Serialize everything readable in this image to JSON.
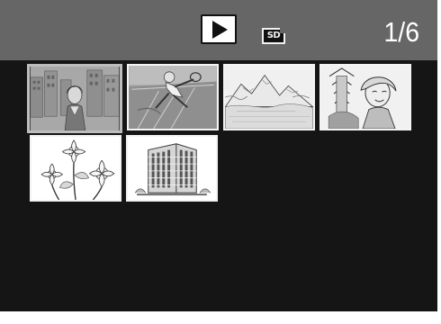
{
  "header": {
    "mode_icon": "play-icon",
    "storage_icon": "sd-card-icon",
    "storage_label": "SD",
    "counter": "1/6"
  },
  "thumbnails": [
    {
      "subject": "woman-city-photo",
      "selected": true
    },
    {
      "subject": "tennis-player-photo",
      "selected": false
    },
    {
      "subject": "mountain-lake-photo",
      "selected": false
    },
    {
      "subject": "woman-temple-photo",
      "selected": false
    },
    {
      "subject": "flowers-photo",
      "selected": false
    },
    {
      "subject": "building-photo",
      "selected": false
    }
  ],
  "colors": {
    "screen_background": "#151515",
    "topbar_background": "#666666",
    "text": "#ffffff"
  }
}
